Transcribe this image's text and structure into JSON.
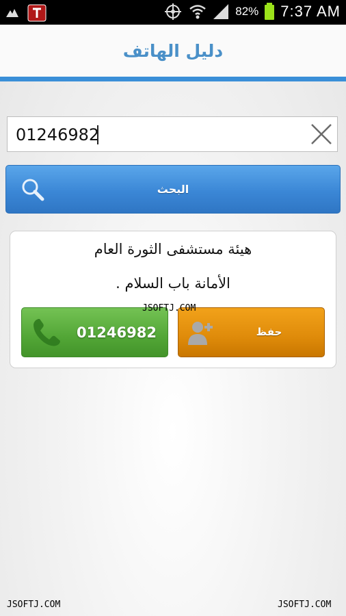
{
  "status_bar": {
    "battery_pct": "82%",
    "time": "7:37 AM",
    "icons": [
      "app-icon-1",
      "app-icon-2",
      "gps-icon",
      "wifi-icon",
      "signal-icon",
      "battery-icon"
    ]
  },
  "header": {
    "title": "دليل الهاتف"
  },
  "search": {
    "value": "01246982",
    "button_label": "البحث"
  },
  "result": {
    "name": "هيئة مستشفى الثورة العام",
    "address": "الأمانة باب السلام .",
    "call_label": "01246982",
    "save_label": "حفظ"
  },
  "watermark": {
    "text": "JSOFTJ.COM"
  },
  "colors": {
    "title": "#4a90c8",
    "accent_strip": "#3a8fd8",
    "search_button": "#3b87d6",
    "call_button": "#52a636",
    "save_button": "#df8b0a"
  }
}
